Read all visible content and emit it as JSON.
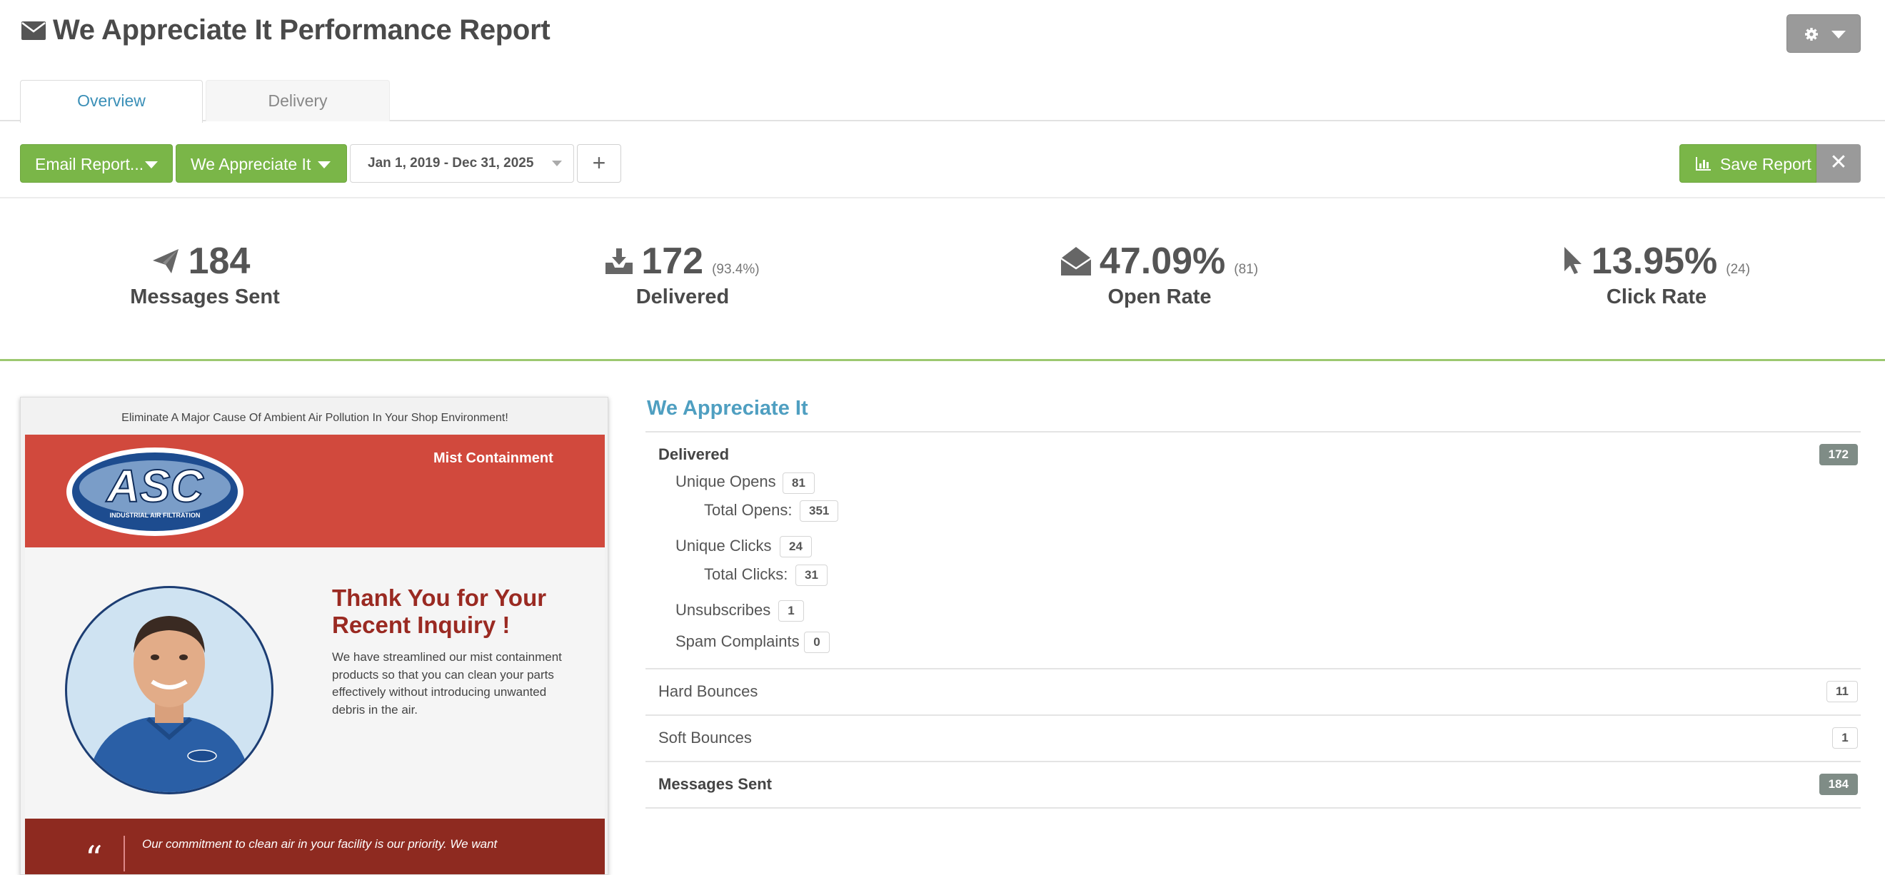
{
  "header": {
    "title": "We Appreciate It Performance Report",
    "title_icon": "envelope-icon",
    "settings_icon": "gear-icon"
  },
  "tabs": [
    {
      "label": "Overview",
      "active": true
    },
    {
      "label": "Delivery",
      "active": false
    }
  ],
  "toolbar": {
    "email_report_label": "Email Report...",
    "campaign_label": "We Appreciate It",
    "date_range": "Jan 1, 2019 - Dec 31, 2025",
    "add_label": "+",
    "save_label": "Save Report",
    "close_label": "✕"
  },
  "stats": [
    {
      "icon": "paper-plane-icon",
      "value": "184",
      "sub": "",
      "label": "Messages Sent"
    },
    {
      "icon": "inbox-download-icon",
      "value": "172",
      "sub": "(93.4%)",
      "label": "Delivered"
    },
    {
      "icon": "envelope-open-icon",
      "value": "47.09%",
      "sub": "(81)",
      "label": "Open Rate"
    },
    {
      "icon": "cursor-icon",
      "value": "13.95%",
      "sub": "(24)",
      "label": "Click Rate"
    }
  ],
  "preview": {
    "preheader": "Eliminate A Major Cause Of Ambient Air Pollution In Your Shop Environment!",
    "logo_text": "ASC",
    "logo_subtext": "INDUSTRIAL AIR FILTRATION",
    "banner_text": "Mist Containment",
    "headline": "Thank You for Your Recent Inquiry !",
    "body": "We have streamlined our mist containment products so that you can clean your parts effectively without introducing unwanted debris in the air.",
    "quote_mark": "“",
    "quote": "Our commitment to clean air in your facility is our priority.  We want"
  },
  "details": {
    "campaign_name": "We Appreciate It",
    "delivered_label": "Delivered",
    "delivered_value": "172",
    "unique_opens_label": "Unique Opens",
    "unique_opens_value": "81",
    "total_opens_label": "Total Opens:",
    "total_opens_value": "351",
    "unique_clicks_label": "Unique Clicks",
    "unique_clicks_value": "24",
    "total_clicks_label": "Total Clicks:",
    "total_clicks_value": "31",
    "unsubscribes_label": "Unsubscribes",
    "unsubscribes_value": "1",
    "spam_label": "Spam Complaints",
    "spam_value": "0",
    "hard_bounces_label": "Hard Bounces",
    "hard_bounces_value": "11",
    "soft_bounces_label": "Soft Bounces",
    "soft_bounces_value": "1",
    "messages_sent_label": "Messages Sent",
    "messages_sent_value": "184"
  },
  "colors": {
    "green": "#7ab648",
    "gray_button": "#9a9a9a",
    "accent_blue": "#4f9fc1",
    "banner_red": "#d1493d",
    "headline_red": "#9a2a22"
  }
}
